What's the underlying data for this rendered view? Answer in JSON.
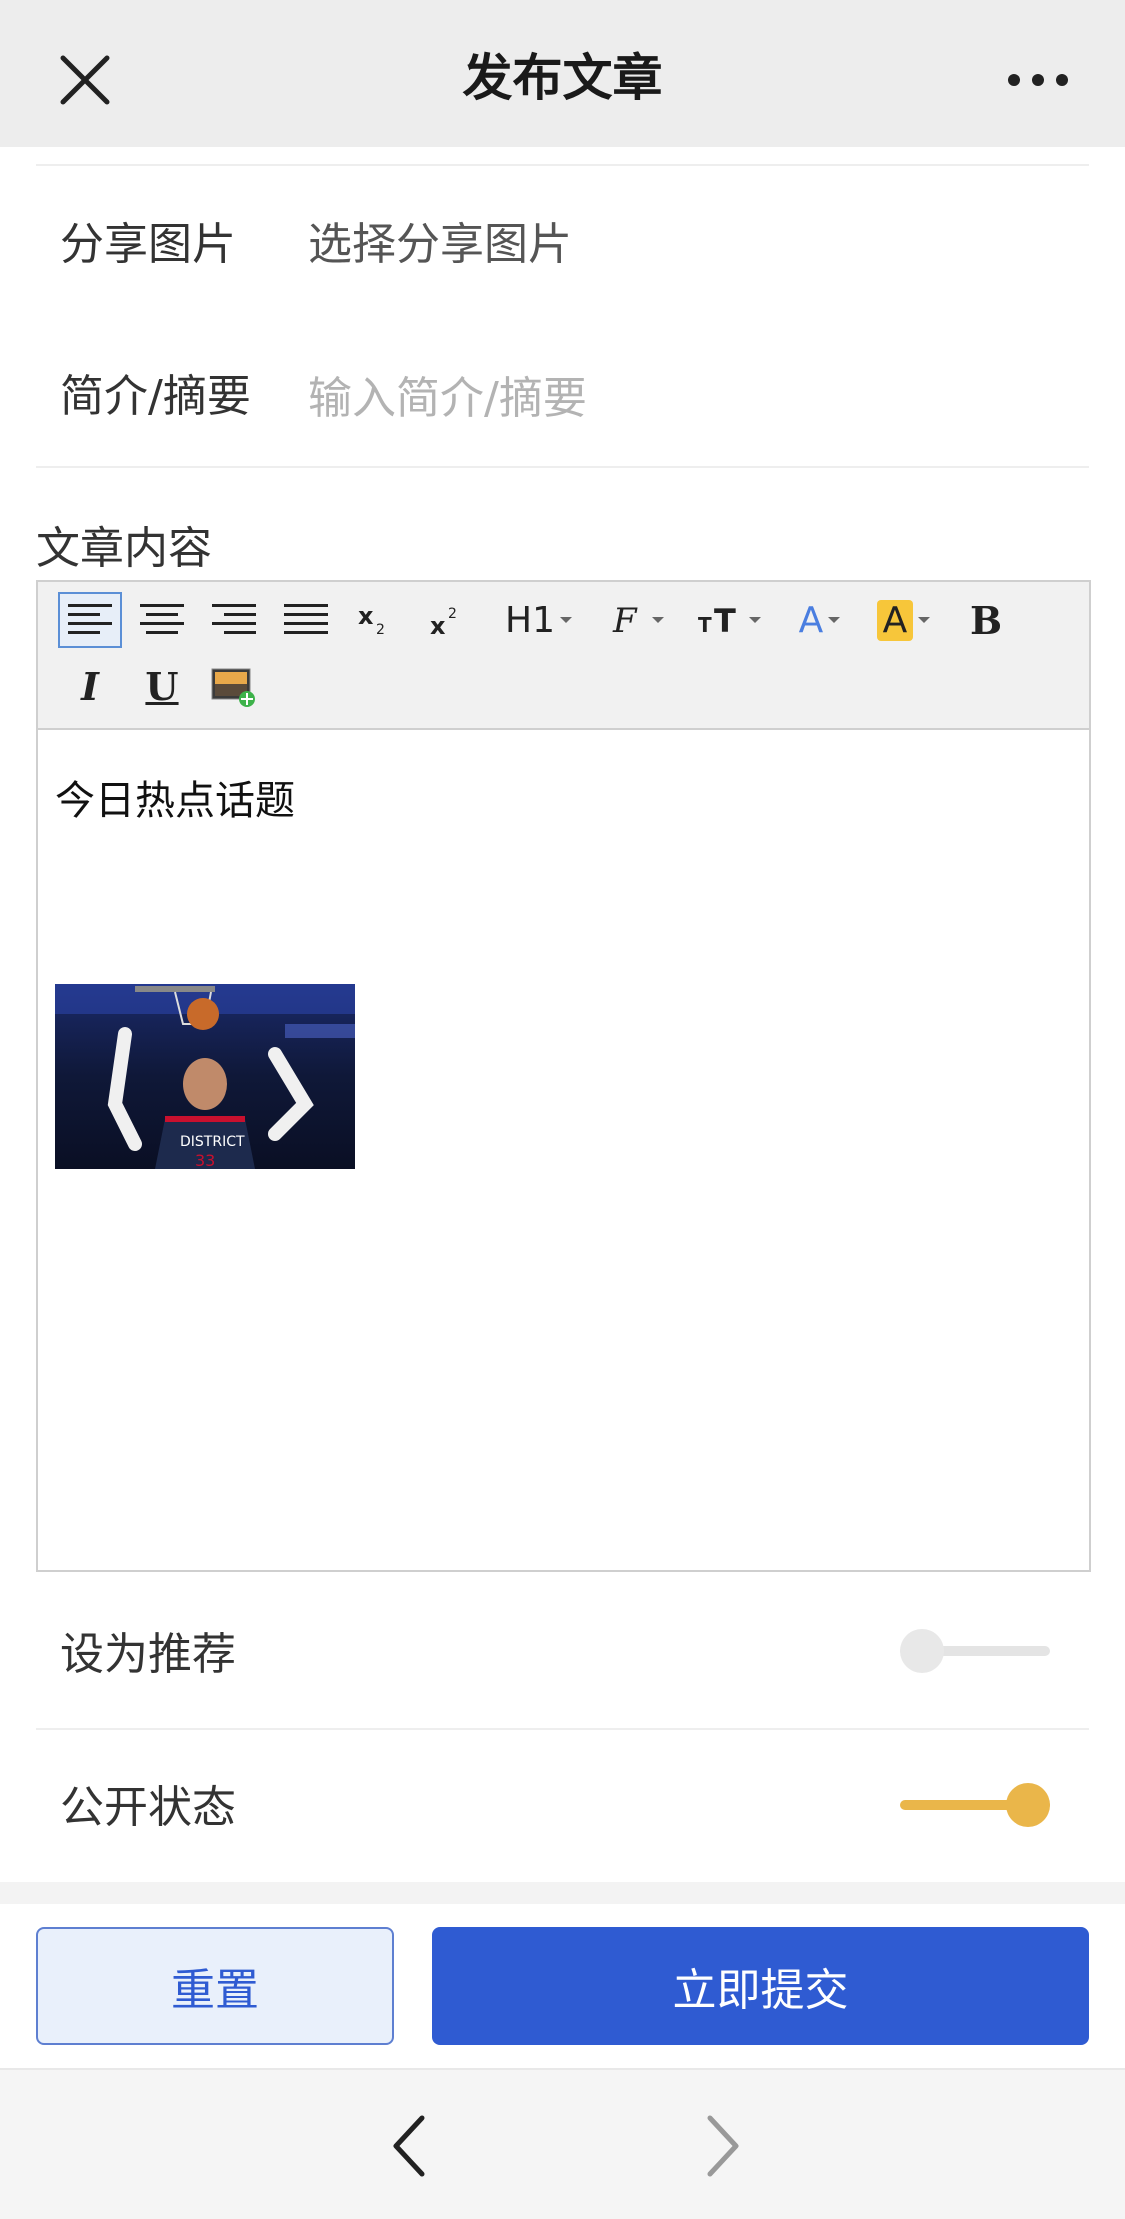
{
  "header": {
    "title": "发布文章",
    "close_icon": "close-icon",
    "more_icon": "more-icon"
  },
  "form": {
    "share_image": {
      "label": "分享图片",
      "value": "选择分享图片"
    },
    "summary": {
      "label": "简介/摘要",
      "placeholder": "输入简介/摘要"
    },
    "content": {
      "label": "文章内容",
      "text": "今日热点话题"
    },
    "recommend": {
      "label": "设为推荐",
      "on": false
    },
    "public": {
      "label": "公开状态",
      "on": true
    }
  },
  "toolbar": {
    "h1": "H1",
    "font_size": "TT",
    "font_color": "A",
    "bg_color": "A",
    "bold": "B",
    "italic": "I",
    "underline": "U"
  },
  "buttons": {
    "reset": "重置",
    "submit": "立即提交"
  },
  "colors": {
    "accent": "#2f5bd2",
    "toggle_on": "#eab64a",
    "toggle_off": "#e4e4e4"
  }
}
